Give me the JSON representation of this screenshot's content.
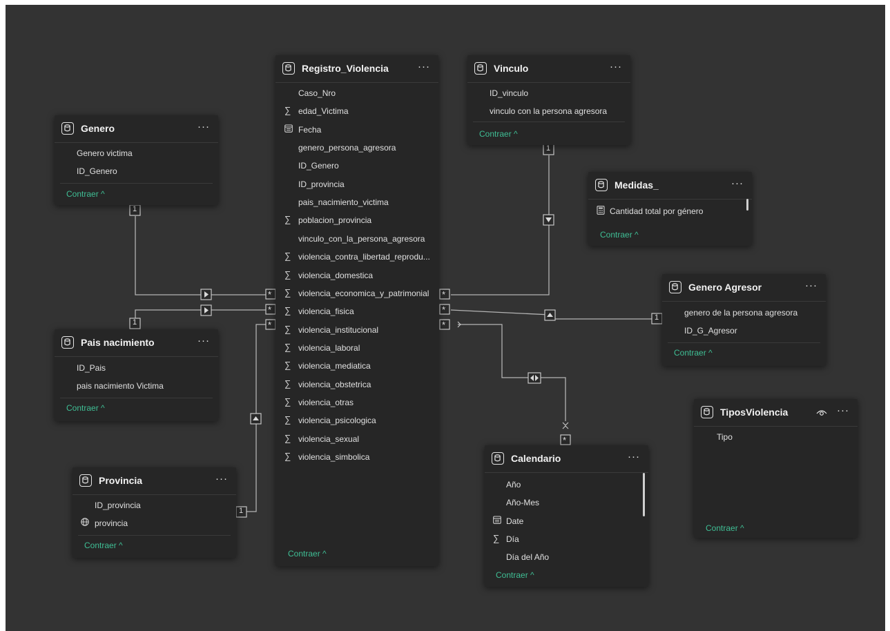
{
  "ui": {
    "collapse_label": "Contraer ^",
    "more_label": "···",
    "sigma": "∑",
    "one": "1",
    "many": "*"
  },
  "tables": {
    "genero": {
      "title": "Genero",
      "fields": [
        "Genero victima",
        "ID_Genero"
      ]
    },
    "pais": {
      "title": "Pais nacimiento",
      "fields": [
        "ID_Pais",
        "pais nacimiento Victima"
      ]
    },
    "provincia": {
      "title": "Provincia",
      "fields": [
        "ID_provincia",
        "provincia"
      ]
    },
    "registro": {
      "title": "Registro_Violencia",
      "fields": [
        "Caso_Nro",
        "edad_Victima",
        "Fecha",
        "genero_persona_agresora",
        "ID_Genero",
        "ID_provincia",
        "pais_nacimiento_victima",
        "poblacion_provincia",
        "vinculo_con_la_persona_agresora",
        "violencia_contra_libertad_reprodu...",
        "violencia_domestica",
        "violencia_economica_y_patrimonial",
        "violencia_fisica",
        "violencia_institucional",
        "violencia_laboral",
        "violencia_mediatica",
        "violencia_obstetrica",
        "violencia_otras",
        "violencia_psicologica",
        "violencia_sexual",
        "violencia_simbolica"
      ]
    },
    "vinculo": {
      "title": "Vinculo",
      "fields": [
        "ID_vinculo",
        "vinculo con la persona agresora"
      ]
    },
    "medidas": {
      "title": "Medidas_",
      "fields": [
        "Cantidad total por género"
      ]
    },
    "genero_agresor": {
      "title": "Genero Agresor",
      "fields": [
        "genero de la persona agresora",
        "ID_G_Agresor"
      ]
    },
    "tipos": {
      "title": "TiposViolencia",
      "fields": [
        "Tipo"
      ]
    },
    "calendario": {
      "title": "Calendario",
      "fields": [
        "Año",
        "Año-Mes",
        "Date",
        "Día",
        "Día del Año"
      ]
    }
  },
  "colors": {
    "canvas": "#333333",
    "card": "#262626",
    "accent": "#3fbf95",
    "line": "#b0b0b0"
  }
}
